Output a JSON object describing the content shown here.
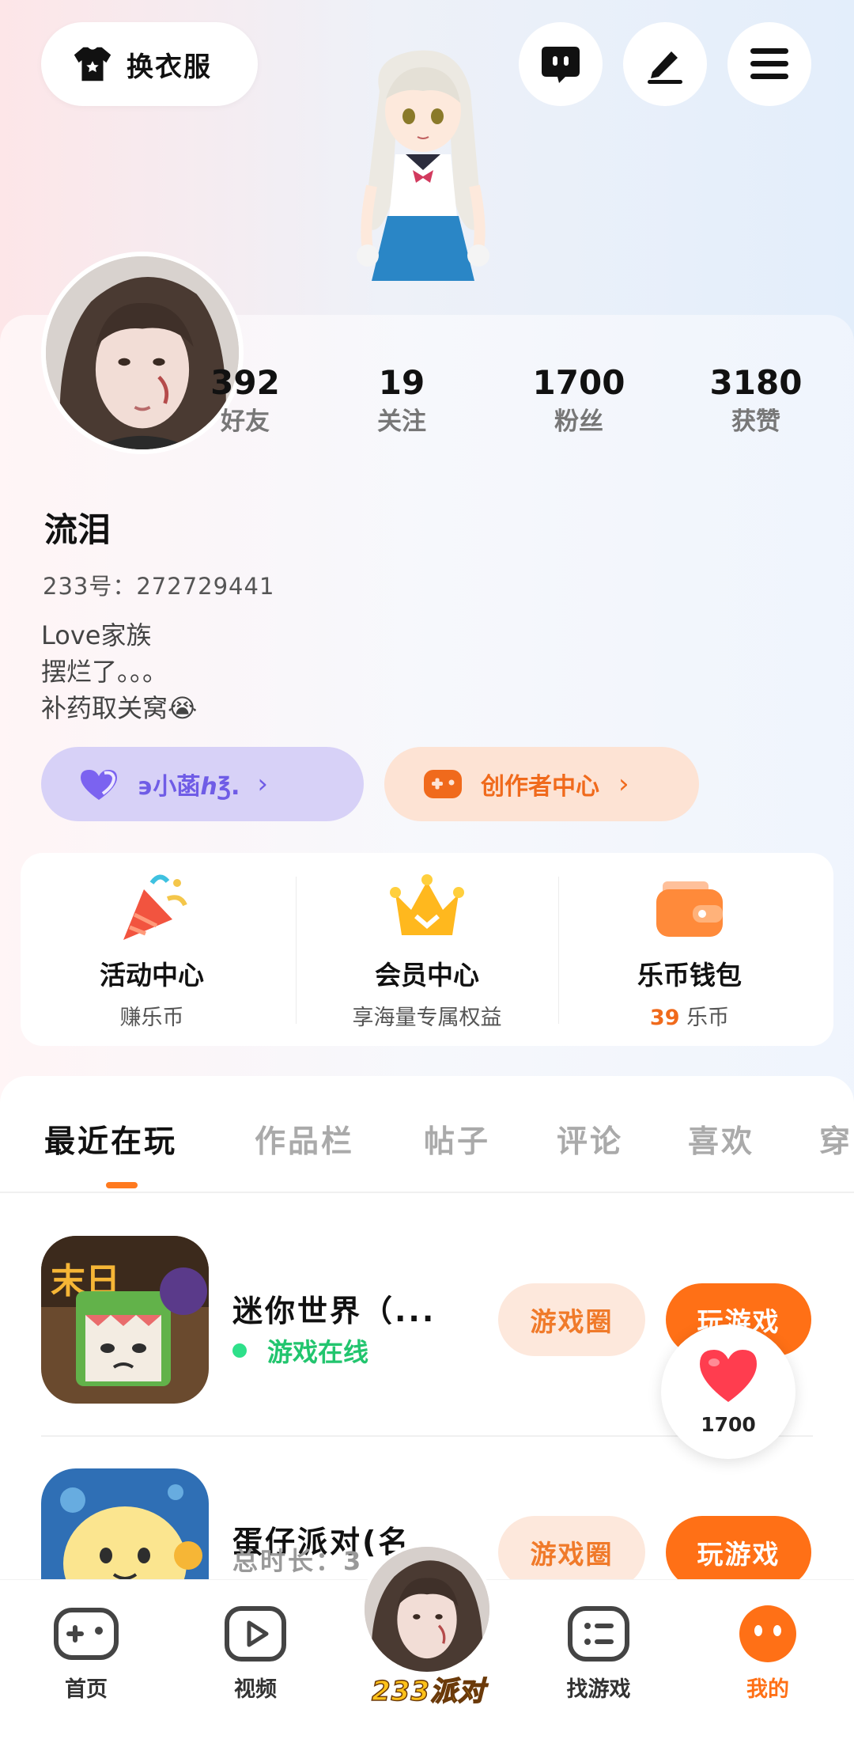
{
  "header": {
    "outfit_label": "换衣服",
    "icons": [
      "tshirt-icon",
      "chat-icon",
      "edit-icon",
      "menu-icon"
    ]
  },
  "stats": [
    {
      "value": "392",
      "label": "好友"
    },
    {
      "value": "19",
      "label": "关注"
    },
    {
      "value": "1700",
      "label": "粉丝"
    },
    {
      "value": "3180",
      "label": "获赞"
    }
  ],
  "profile": {
    "name": "流泪",
    "uid": "233号：272729441",
    "bio": [
      "Love家族",
      "摆烂了。。。",
      "补药取关窝😭"
    ]
  },
  "pills": {
    "family": "϶小菡ℎ℥.",
    "creator": "创作者中心"
  },
  "services": [
    {
      "title": "活动中心",
      "sub": "赚乐币",
      "icon": "party-popper-icon"
    },
    {
      "title": "会员中心",
      "sub": "享海量专属权益",
      "icon": "crown-icon"
    },
    {
      "title": "乐币钱包",
      "sub_value": "39",
      "sub_unit": "乐币",
      "icon": "wallet-icon"
    }
  ],
  "tabs": [
    "最近在玩",
    "作品栏",
    "帖子",
    "评论",
    "喜欢",
    "穿"
  ],
  "games": [
    {
      "name": "迷你世界（...",
      "status": "游戏在线",
      "circle_btn": "游戏圈",
      "play_btn": "玩游戏"
    },
    {
      "name": "蛋仔派对(名...",
      "meta": "总时长：3",
      "circle_btn": "游戏圈",
      "play_btn": "玩游戏"
    }
  ],
  "like_fab": {
    "count": "1700"
  },
  "nav": [
    {
      "label": "首页",
      "icon": "gamepad-icon"
    },
    {
      "label": "视频",
      "icon": "video-icon"
    },
    {
      "label": "233派对",
      "icon": "avatar"
    },
    {
      "label": "找游戏",
      "icon": "list-icon"
    },
    {
      "label": "我的",
      "icon": "face-icon"
    }
  ],
  "colors": {
    "accent": "#ff7016",
    "purple": "#6f5ce6",
    "online": "#22c56e"
  }
}
